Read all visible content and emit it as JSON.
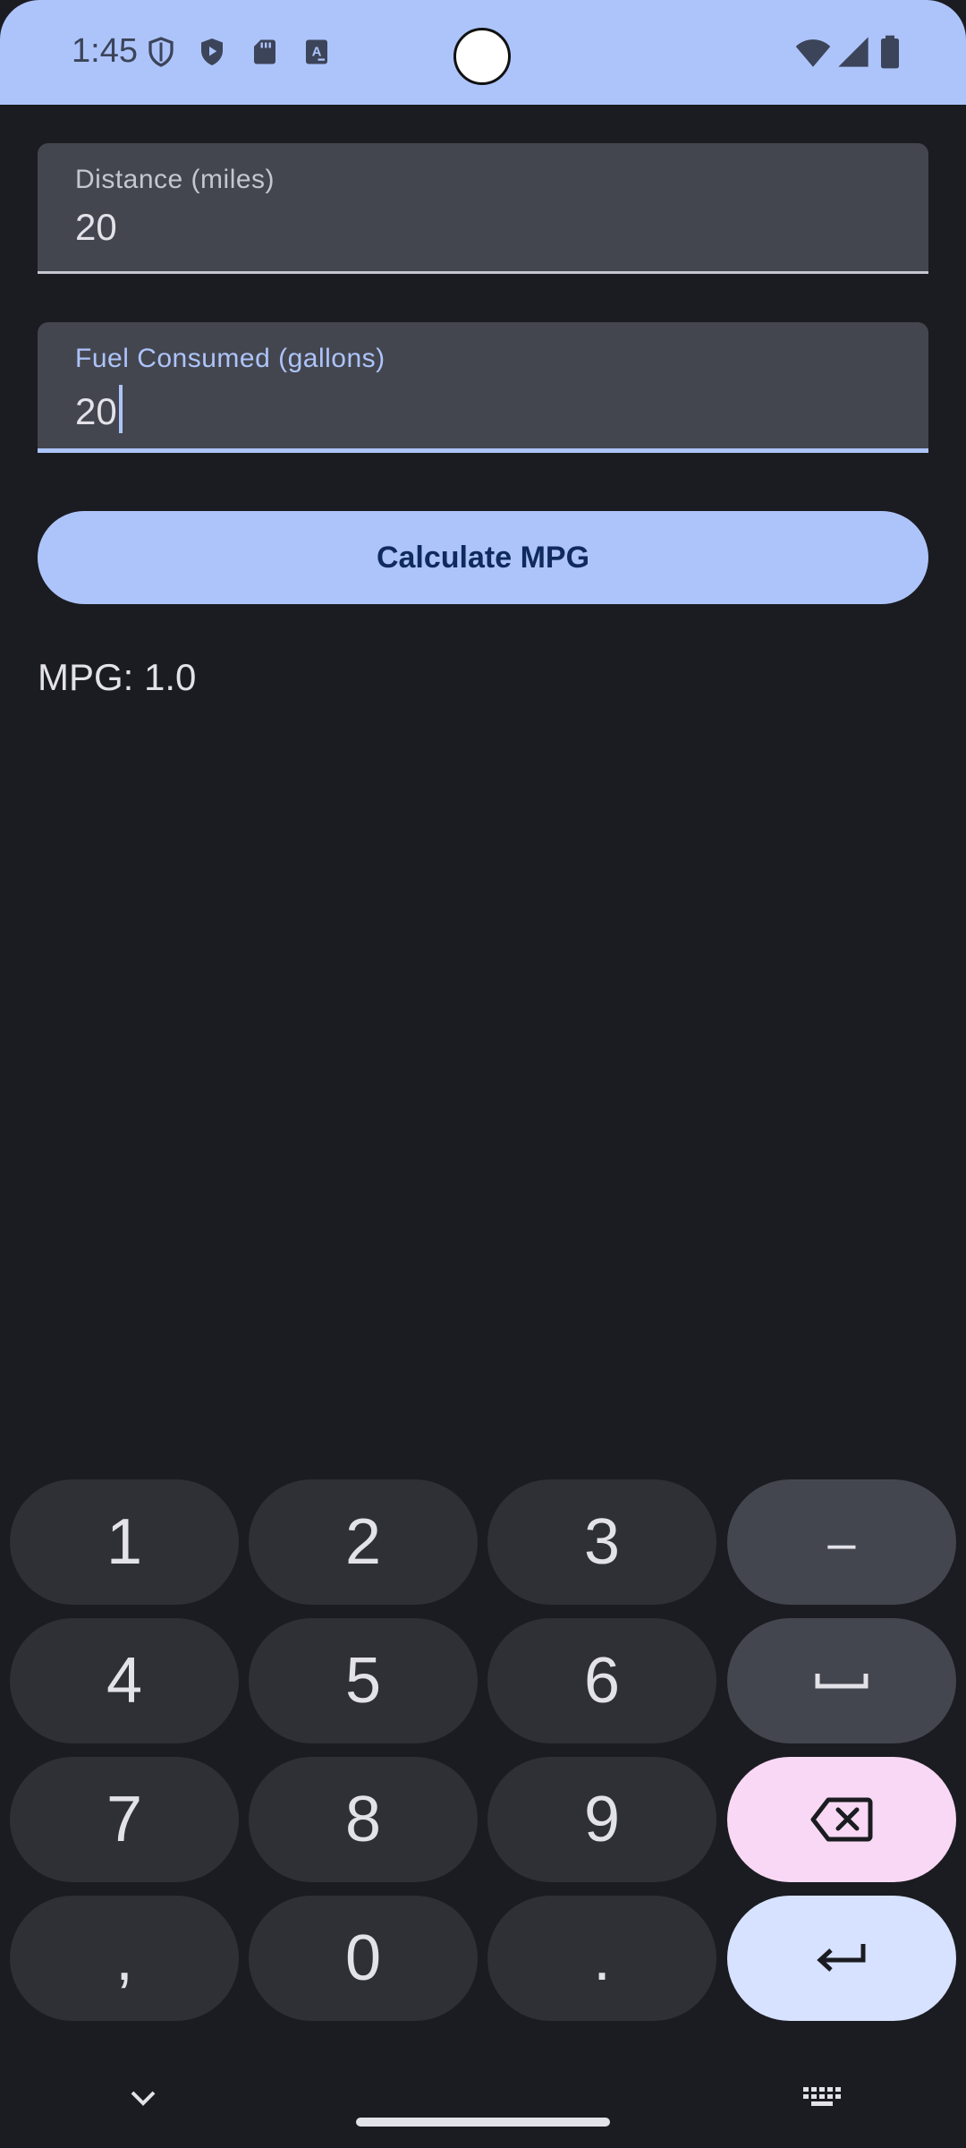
{
  "status_bar": {
    "time": "1:45",
    "icons": [
      "shield-outline-icon",
      "play-shield-icon",
      "sd-card-icon",
      "text-a-icon"
    ],
    "right_icons": [
      "wifi-icon",
      "signal-icon",
      "battery-icon"
    ],
    "background": "#adc4fb"
  },
  "form": {
    "distance": {
      "label": "Distance (miles)",
      "value": "20"
    },
    "fuel": {
      "label": "Fuel Consumed (gallons)",
      "value": "20"
    },
    "calculate_label": "Calculate MPG",
    "result": "MPG: 1.0"
  },
  "keyboard": {
    "keys": {
      "k1": "1",
      "k2": "2",
      "k3": "3",
      "minus": "–",
      "k4": "4",
      "k5": "5",
      "k6": "6",
      "k7": "7",
      "k8": "8",
      "k9": "9",
      "comma": ",",
      "k0": "0",
      "period": "."
    },
    "icons": [
      "space-icon",
      "backspace-icon",
      "enter-icon",
      "chevron-down-icon",
      "keyboard-icon"
    ]
  },
  "colors": {
    "accent": "#adc4fb",
    "background": "#1b1c21",
    "backspace": "#f8d8f4",
    "enter": "#d6e2ff"
  }
}
